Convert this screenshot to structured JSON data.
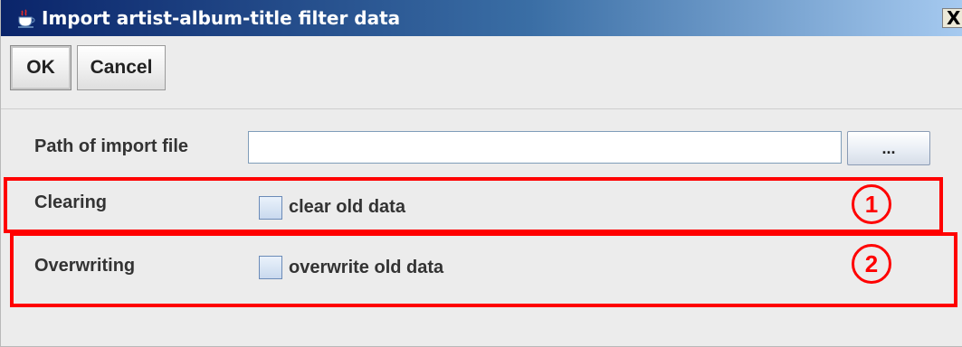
{
  "window": {
    "title": "Import artist-album-title filter data",
    "close_glyph": "X",
    "icon": "java-coffee-cup-icon"
  },
  "toolbar": {
    "ok_label": "OK",
    "cancel_label": "Cancel"
  },
  "form": {
    "path_label": "Path of import file",
    "path_value": "",
    "browse_label": "...",
    "clearing_label": "Clearing",
    "clear_checkbox_label": "clear old data",
    "clear_checked": false,
    "overwriting_label": "Overwriting",
    "overwrite_checkbox_label": "overwrite old data",
    "overwrite_checked": false
  },
  "annotations": {
    "marker_1": "1",
    "marker_2": "2",
    "color": "#ff0000"
  },
  "colors": {
    "titlebar_start": "#0a246a",
    "titlebar_end": "#a6caf0",
    "window_bg": "#ececec"
  }
}
